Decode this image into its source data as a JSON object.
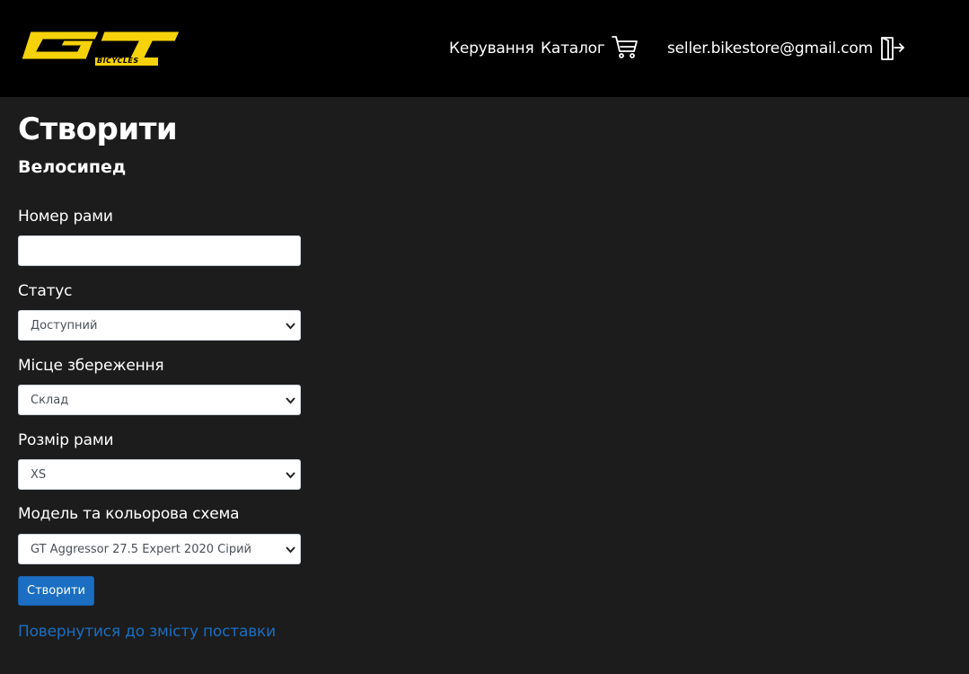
{
  "header": {
    "logo_text": "GT",
    "logo_sub": "BICYCLES",
    "nav_manage": "Керування",
    "nav_catalog": "Каталог",
    "cart_icon": "cart-icon",
    "user_email": "seller.bikestore@gmail.com",
    "logout_icon": "logout-icon"
  },
  "page": {
    "title": "Створити",
    "subtitle": "Велосипед"
  },
  "form": {
    "frame_number": {
      "label": "Номер рами",
      "value": ""
    },
    "status": {
      "label": "Статус",
      "value": "Доступний"
    },
    "storage": {
      "label": "Місце збереження",
      "value": "Склад"
    },
    "frame_size": {
      "label": "Розмір рами",
      "value": "XS"
    },
    "model": {
      "label": "Модель та кольорова схема",
      "value": "GT Aggressor 27.5 Expert 2020 Сірий"
    },
    "submit_label": "Створити",
    "back_link": "Повернутися до змісту поставки"
  },
  "colors": {
    "header_bg": "#000000",
    "page_bg": "#1c1c1c",
    "logo_yellow": "#f5d20a",
    "accent_blue": "#1b6ec2"
  }
}
